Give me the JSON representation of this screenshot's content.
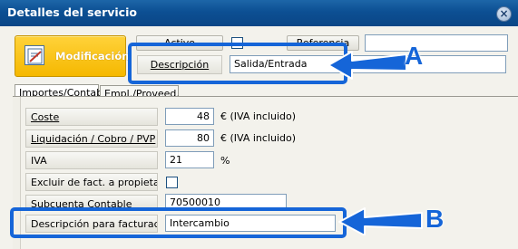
{
  "window": {
    "title": "Detalles del servicio",
    "close_symbol": "×"
  },
  "toolbar": {
    "modificacion_label": "Modificación",
    "activo_label": "Activo",
    "referencia_label": "Referencia"
  },
  "descripcion": {
    "label": "Descripción",
    "value": "Salida/Entrada"
  },
  "tabs": [
    {
      "label": "Importes/Contab."
    },
    {
      "label": "Empl./Proveed."
    }
  ],
  "fields": {
    "coste": {
      "label": "Coste",
      "value": "48",
      "unit": "€ (IVA incluido)"
    },
    "liquidacion": {
      "label": "Liquidación / Cobro / PVP",
      "value": "80",
      "unit": "€ (IVA incluido)"
    },
    "iva": {
      "label": "IVA",
      "value": "21",
      "unit": "%"
    },
    "excluir": {
      "label": "Excluir de fact. a propietarios"
    },
    "subcuenta": {
      "label": "Subcuenta Contable",
      "value": "70500010"
    },
    "desc_fact": {
      "label": "Descripción para facturación",
      "value": "Intercambio"
    }
  },
  "annotations": {
    "a": "A",
    "b": "B"
  },
  "colors": {
    "highlight": "#1565d8",
    "tile": "#f5b800",
    "titlebar": "#0c4f93"
  }
}
